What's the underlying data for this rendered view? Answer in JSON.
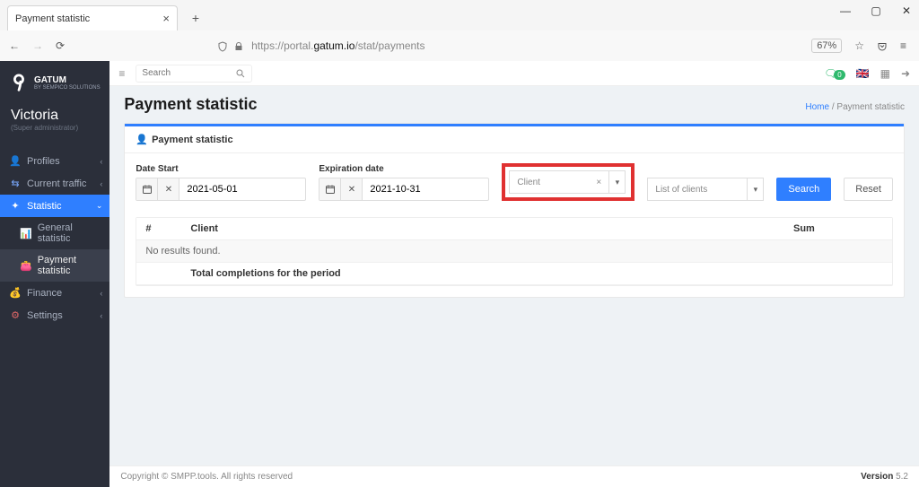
{
  "browser": {
    "tab_title": "Payment statistic",
    "url_prefix": "https://portal.",
    "url_domain": "gatum.io",
    "url_path": "/stat/payments",
    "zoom": "67%"
  },
  "brand": {
    "name": "GATUM",
    "sub": "BY SEMPICO SOLUTIONS"
  },
  "user": {
    "name": "Victoria",
    "role": "(Super administrator)"
  },
  "sidebar": {
    "items": [
      {
        "icon": "user-icon",
        "label": "Profiles",
        "expandable": true
      },
      {
        "icon": "traffic-icon",
        "label": "Current traffic",
        "expandable": true
      },
      {
        "icon": "stat-icon",
        "label": "Statistic",
        "expandable": true,
        "active": true
      },
      {
        "icon": "chart-icon",
        "label": "General statistic",
        "sub": true
      },
      {
        "icon": "payment-icon",
        "label": "Payment statistic",
        "sub": true,
        "current": true
      },
      {
        "icon": "finance-icon",
        "label": "Finance",
        "expandable": true
      },
      {
        "icon": "settings-icon",
        "label": "Settings",
        "expandable": true
      }
    ]
  },
  "topbar": {
    "search_placeholder": "Search",
    "notif_badge": "0"
  },
  "page": {
    "title": "Payment statistic",
    "breadcrumb_home": "Home",
    "breadcrumb_current": "Payment statistic",
    "panel_title": "Payment statistic"
  },
  "filters": {
    "date_start_label": "Date Start",
    "date_start_value": "2021-05-01",
    "date_end_label": "Expiration date",
    "date_end_value": "2021-10-31",
    "client_placeholder": "Client",
    "list_placeholder": "List of clients",
    "search_btn": "Search",
    "reset_btn": "Reset"
  },
  "table": {
    "col_num": "#",
    "col_client": "Client",
    "col_sum": "Sum",
    "empty_msg": "No results found.",
    "total_label": "Total completions for the period"
  },
  "footer": {
    "copyright": "Copyright © SMPP.tools. All rights reserved",
    "version_label": "Version",
    "version_value": "5.2"
  }
}
